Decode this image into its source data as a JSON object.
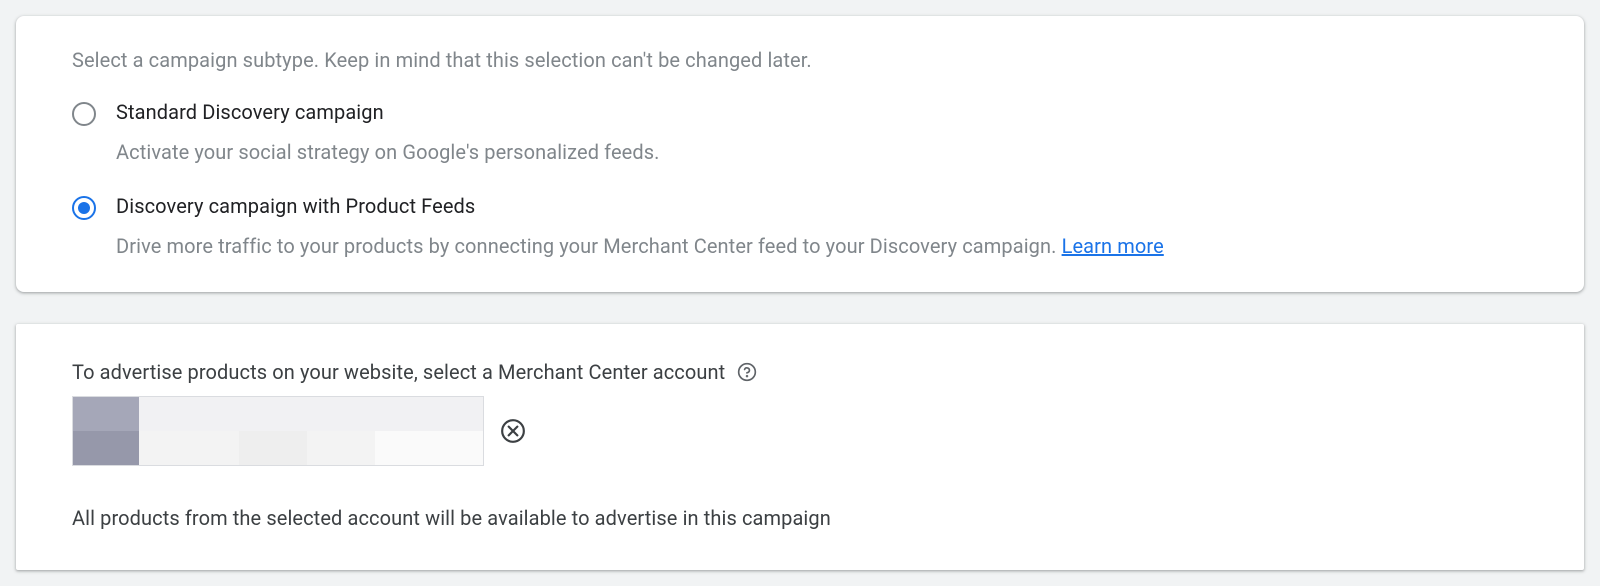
{
  "subtype": {
    "intro": "Select a campaign subtype. Keep in mind that this selection can't be changed later.",
    "options": [
      {
        "title": "Standard Discovery campaign",
        "description": "Activate your social strategy on Google's personalized feeds.",
        "selected": false
      },
      {
        "title": "Discovery campaign with Product Feeds",
        "description": "Drive more traffic to your products by connecting your Merchant Center feed to your Discovery campaign. ",
        "learn_more": "Learn more",
        "selected": true
      }
    ]
  },
  "merchant": {
    "label": "To advertise products on your website, select a Merchant Center account",
    "note": "All products from the selected account will be available to advertise in this campaign"
  }
}
